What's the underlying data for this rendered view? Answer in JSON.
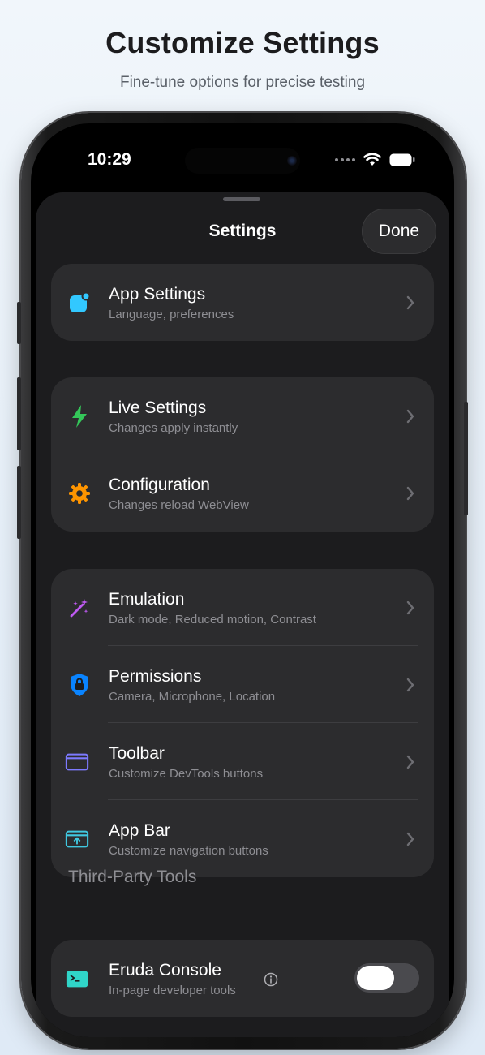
{
  "promo": {
    "headline": "Customize Settings",
    "subhead": "Fine-tune options for precise testing"
  },
  "status_bar": {
    "time": "10:29"
  },
  "nav": {
    "title": "Settings",
    "done_label": "Done"
  },
  "groups": [
    {
      "items": [
        {
          "title": "App Settings",
          "subtitle": "Language, preferences",
          "icon": "app-settings-icon",
          "icon_color": "#32c8ff"
        }
      ]
    },
    {
      "items": [
        {
          "title": "Live Settings",
          "subtitle": "Changes apply instantly",
          "icon": "bolt-icon",
          "icon_color": "#34c759"
        },
        {
          "title": "Configuration",
          "subtitle": "Changes reload WebView",
          "icon": "gear-icon",
          "icon_color": "#ff9500"
        }
      ]
    },
    {
      "items": [
        {
          "title": "Emulation",
          "subtitle": "Dark mode, Reduced motion, Contrast",
          "icon": "magic-wand-icon",
          "icon_color": "#bf5af2"
        },
        {
          "title": "Permissions",
          "subtitle": "Camera, Microphone, Location",
          "icon": "lock-shield-icon",
          "icon_color": "#0a84ff"
        },
        {
          "title": "Toolbar",
          "subtitle": "Customize DevTools buttons",
          "icon": "toolbar-icon",
          "icon_color": "#7d7aff"
        },
        {
          "title": "App Bar",
          "subtitle": "Customize navigation buttons",
          "icon": "app-bar-icon",
          "icon_color": "#40c8e0"
        }
      ]
    }
  ],
  "third_party": {
    "header": "Third-Party Tools",
    "items": [
      {
        "title": "Eruda Console",
        "subtitle": "In-page developer tools",
        "icon": "terminal-icon",
        "icon_color": "#30d5c8",
        "enabled": false
      }
    ]
  },
  "colors": {
    "sheet_bg": "#1c1c1e",
    "group_bg": "#2c2c2e",
    "secondary_text": "#8e8e93"
  }
}
